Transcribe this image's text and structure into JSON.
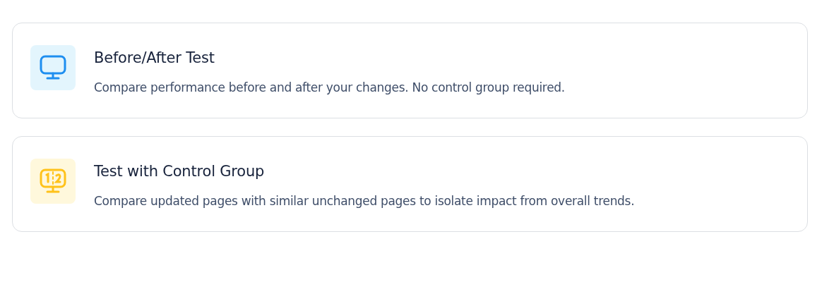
{
  "options": [
    {
      "kind": "monitor",
      "title": "Before/After Test",
      "description": "Compare performance before and after your changes. No control group required."
    },
    {
      "kind": "split",
      "title": "Test with Control Group",
      "description": "Compare updated pages with similar unchanged pages to isolate impact from overall trends."
    }
  ]
}
